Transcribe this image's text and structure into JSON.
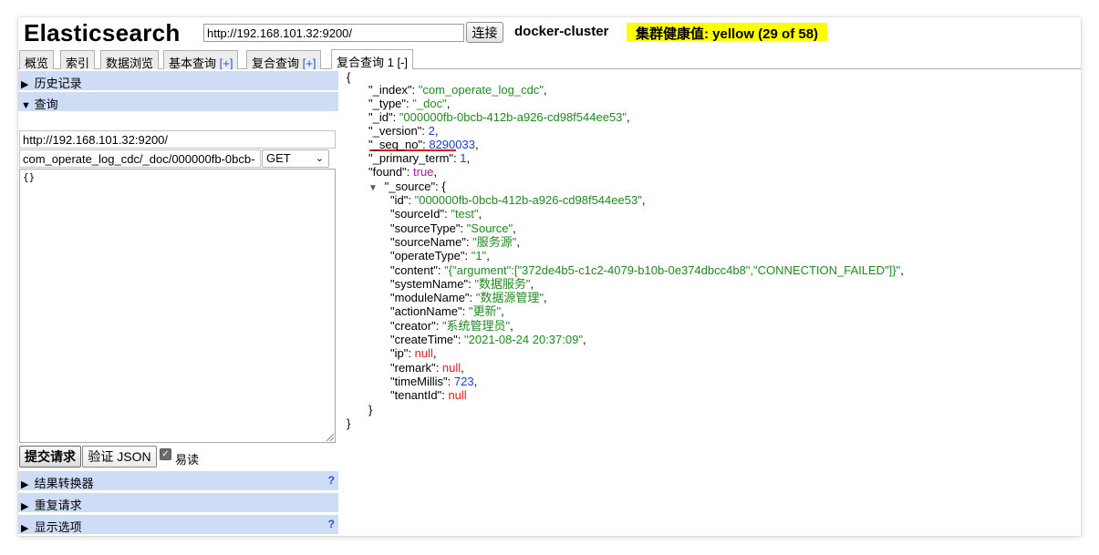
{
  "header": {
    "app_title": "Elasticsearch",
    "url_value": "http://192.168.101.32:9200/",
    "connect_label": "连接",
    "cluster_name": "docker-cluster",
    "health_text": "集群健康值: yellow (29 of 58)",
    "health_color": "#ffff00"
  },
  "tabs": [
    {
      "label": "概览"
    },
    {
      "label": "索引"
    },
    {
      "label": "数据浏览"
    },
    {
      "label": "基本查询",
      "suffix": "[+]"
    },
    {
      "label": "复合查询",
      "suffix": "[+]"
    },
    {
      "label": "复合查询 1 [-]"
    }
  ],
  "left": {
    "history_label": "历史记录",
    "query_label": "查询",
    "server_url": "http://192.168.101.32:9200/",
    "path": "com_operate_log_cdc/_doc/000000fb-0bcb-",
    "method": "GET",
    "body": "{}",
    "submit_label": "提交请求",
    "validate_label": "验证 JSON",
    "pretty_label": "易读",
    "pretty_checked": true,
    "transformer_label": "结果转换器",
    "repeat_label": "重复请求",
    "display_label": "显示选项",
    "help_glyph": "?"
  },
  "result": {
    "open_brace": "{",
    "close_brace": "}",
    "index_key": "\"_index\"",
    "index_val": "\"com_operate_log_cdc\"",
    "type_key": "\"_type\"",
    "type_val": "\"_doc\"",
    "id_key": "\"_id\"",
    "id_val": "\"000000fb-0bcb-412b-a926-cd98f544ee53\"",
    "version_key": "\"_version\"",
    "version_val": "2",
    "seq_key": "\"_seq_no\"",
    "seq_val": "8290033",
    "primary_key": "\"_primary_term\"",
    "primary_val": "1",
    "found_key": "\"found\"",
    "found_val": "true",
    "source_key": "\"_source\"",
    "source": [
      {
        "k": "\"id\"",
        "v": "\"000000fb-0bcb-412b-a926-cd98f544ee53\"",
        "t": "s"
      },
      {
        "k": "\"sourceId\"",
        "v": "\"test\"",
        "t": "s"
      },
      {
        "k": "\"sourceType\"",
        "v": "\"Source\"",
        "t": "s"
      },
      {
        "k": "\"sourceName\"",
        "v": "\"服务源\"",
        "t": "s"
      },
      {
        "k": "\"operateType\"",
        "v": "\"1\"",
        "t": "s"
      },
      {
        "k": "\"content\"",
        "v": "\"{\"argument\":[\"372de4b5-c1c2-4079-b10b-0e374dbcc4b8\",\"CONNECTION_FAILED\"]}\"",
        "t": "s"
      },
      {
        "k": "\"systemName\"",
        "v": "\"数据服务\"",
        "t": "s"
      },
      {
        "k": "\"moduleName\"",
        "v": "\"数据源管理\"",
        "t": "s"
      },
      {
        "k": "\"actionName\"",
        "v": "\"更新\"",
        "t": "s"
      },
      {
        "k": "\"creator\"",
        "v": "\"系统管理员\"",
        "t": "s"
      },
      {
        "k": "\"createTime\"",
        "v": "\"2021-08-24 20:37:09\"",
        "t": "s"
      },
      {
        "k": "\"ip\"",
        "v": "null",
        "t": "nl"
      },
      {
        "k": "\"remark\"",
        "v": "null",
        "t": "nl"
      },
      {
        "k": "\"timeMillis\"",
        "v": "723",
        "t": "n"
      },
      {
        "k": "\"tenantId\"",
        "v": "null",
        "t": "nl"
      }
    ]
  }
}
